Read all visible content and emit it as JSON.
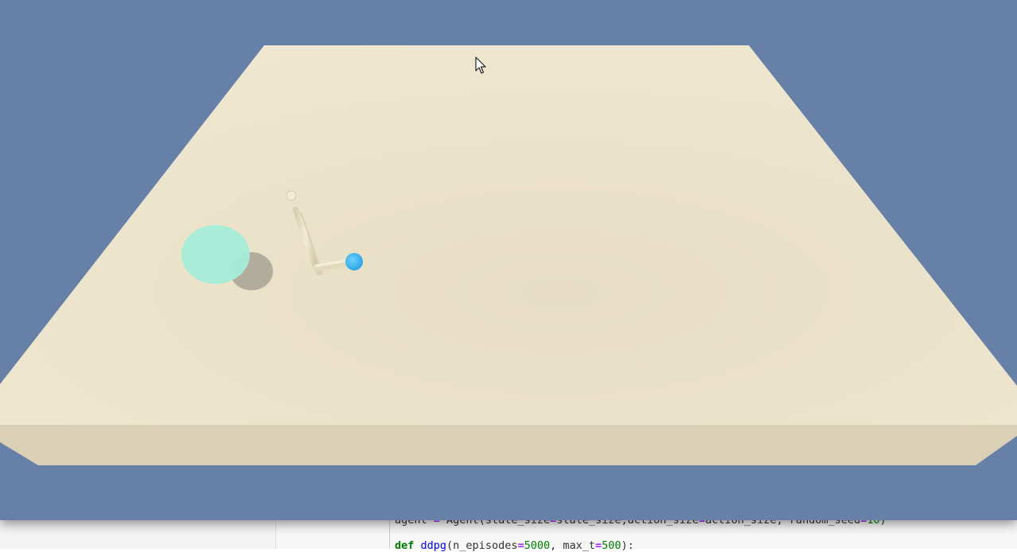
{
  "simulation": {
    "colors": {
      "background": "#6680a8",
      "floor_top": "#ebe3ca",
      "floor_front": "#d9d0b6",
      "target": "#a5ecd8",
      "fingertip": "#3bb6f0",
      "arm": "#e8dfc2"
    }
  },
  "notebook": {
    "code": {
      "line1": {
        "a": "agent ",
        "b": "=",
        "c": " Agent(state_size",
        "d": "=",
        "e": "state_size,action_size",
        "f": "=",
        "g": "action_size, random_seed",
        "h": "=",
        "i": "10",
        "j": ")"
      },
      "line2": {
        "kw": "def",
        "fn": "ddpg",
        "a": "(n_episodes",
        "b": "=",
        "c": "5000",
        "d": ", max_t",
        "e": "=",
        "f": "500",
        "g": "):"
      }
    }
  }
}
